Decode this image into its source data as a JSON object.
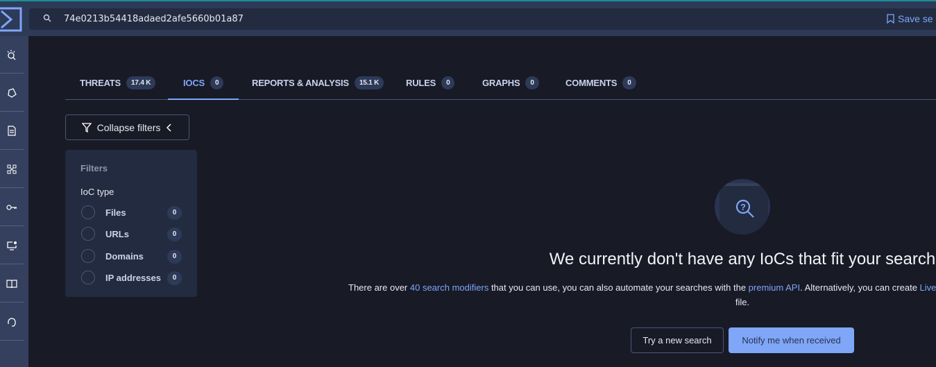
{
  "search": {
    "value": "74e0213b54418adaed2afe5660b01a87",
    "save_label": "Save se"
  },
  "sidebar": {
    "items": [
      "threat-hunt",
      "malware",
      "reports",
      "graphs",
      "credentials",
      "livehunt",
      "docs",
      "support"
    ]
  },
  "tabs": [
    {
      "label": "THREATS",
      "count": "17.4 K"
    },
    {
      "label": "IOCS",
      "count": "0"
    },
    {
      "label": "REPORTS & ANALYSIS",
      "count": "15.1 K"
    },
    {
      "label": "RULES",
      "count": "0"
    },
    {
      "label": "GRAPHS",
      "count": "0"
    },
    {
      "label": "COMMENTS",
      "count": "0"
    }
  ],
  "filters": {
    "collapse_label": "Collapse filters",
    "title": "Filters",
    "section": "IoC type",
    "options": [
      {
        "label": "Files",
        "count": "0"
      },
      {
        "label": "URLs",
        "count": "0"
      },
      {
        "label": "Domains",
        "count": "0"
      },
      {
        "label": "IP addresses",
        "count": "0"
      }
    ]
  },
  "empty": {
    "headline": "We currently don't have any IoCs that fit your search",
    "desc_1": "There are over ",
    "link_1": "40 search modifiers",
    "desc_2": " that you can use, you can also automate your searches with the ",
    "link_2": "premium API",
    "desc_3": ". Alternatively, you can create ",
    "link_3": "Live",
    "desc_4": "file.",
    "try_label": "Try a new search",
    "notify_label": "Notify me when received"
  },
  "colors": {
    "accent": "#7fa6f7",
    "bg": "#181a26",
    "panel": "#232b40"
  }
}
